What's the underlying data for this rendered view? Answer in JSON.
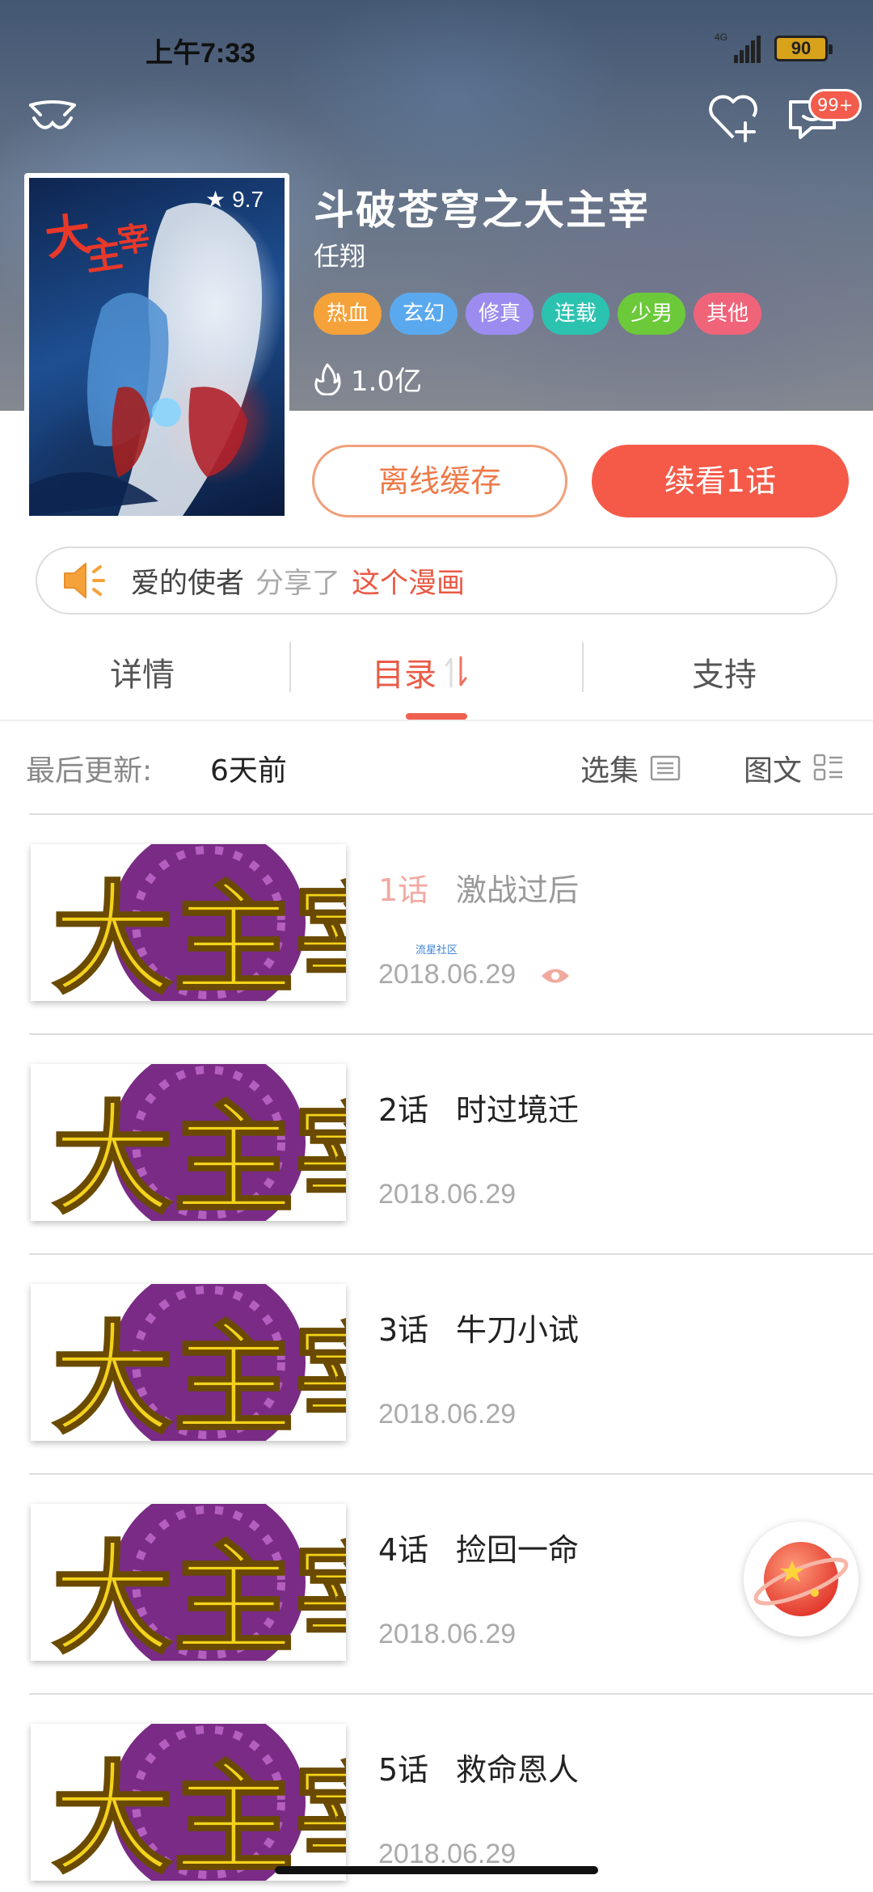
{
  "status_bar": {
    "time": "上午7:33",
    "battery": "90",
    "network": "4G"
  },
  "nav": {
    "message_badge": "99+"
  },
  "comic": {
    "title": "斗破苍穹之大主宰",
    "author": "任翔",
    "rating": "9.7",
    "popularity": "1.0亿",
    "tags": [
      {
        "label": "热血",
        "color": "#f5a23a"
      },
      {
        "label": "玄幻",
        "color": "#5aa9ef"
      },
      {
        "label": "修真",
        "color": "#9c8cf0"
      },
      {
        "label": "连载",
        "color": "#2cc2b0"
      },
      {
        "label": "少男",
        "color": "#6cc93a"
      },
      {
        "label": "其他",
        "color": "#f0647a"
      }
    ]
  },
  "actions": {
    "offline": "离线缓存",
    "continue": "续看1话"
  },
  "share": {
    "user": "爱的使者",
    "action": "分享了",
    "link": "这个漫画"
  },
  "tabs": {
    "detail": "详情",
    "catalog": "目录",
    "support": "支持"
  },
  "list_header": {
    "last_update_label": "最后更新:",
    "last_update_value": "6天前",
    "select": "选集",
    "view_mode": "图文"
  },
  "episodes": [
    {
      "number": "1话",
      "title": "激战过后",
      "date": "2018.06.29",
      "read": true,
      "watermark": "流星社区"
    },
    {
      "number": "2话",
      "title": "时过境迁",
      "date": "2018.06.29",
      "read": false
    },
    {
      "number": "3话",
      "title": "牛刀小试",
      "date": "2018.06.29",
      "read": false
    },
    {
      "number": "4话",
      "title": "捡回一命",
      "date": "2018.06.29",
      "read": false
    },
    {
      "number": "5话",
      "title": "救命恩人",
      "date": "2018.06.29",
      "read": false
    }
  ],
  "colors": {
    "accent": "#f55a48",
    "accent_text": "#ea5a45",
    "offline_border": "#f0a07a"
  }
}
